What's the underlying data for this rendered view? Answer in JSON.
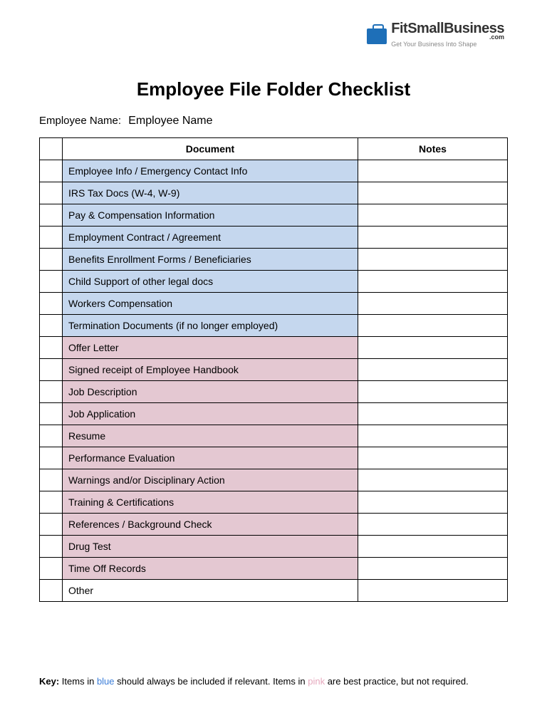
{
  "logo": {
    "brand": "FitSmallBusiness",
    "tag": "Get Your Business Into Shape",
    "dotcom": ".com"
  },
  "title": "Employee File Folder Checklist",
  "empLabel": "Employee Name:",
  "empValue": "Employee Name",
  "headers": {
    "doc": "Document",
    "notes": "Notes"
  },
  "rows": [
    {
      "text": "Employee Info / Emergency Contact Info",
      "cls": "blue"
    },
    {
      "text": "IRS Tax Docs (W-4, W-9)",
      "cls": "blue"
    },
    {
      "text": "Pay & Compensation Information",
      "cls": "blue"
    },
    {
      "text": "Employment Contract / Agreement",
      "cls": "blue"
    },
    {
      "text": "Benefits Enrollment Forms / Beneficiaries",
      "cls": "blue"
    },
    {
      "text": "Child Support of other legal docs",
      "cls": "blue"
    },
    {
      "text": "Workers Compensation",
      "cls": "blue"
    },
    {
      "text": "Termination Documents (if no longer employed)",
      "cls": "blue"
    },
    {
      "text": "Offer Letter",
      "cls": "pink"
    },
    {
      "text": "Signed receipt of Employee Handbook",
      "cls": "pink"
    },
    {
      "text": "Job Description",
      "cls": "pink"
    },
    {
      "text": "Job Application",
      "cls": "pink"
    },
    {
      "text": "Resume",
      "cls": "pink"
    },
    {
      "text": "Performance Evaluation",
      "cls": "pink"
    },
    {
      "text": "Warnings and/or Disciplinary Action",
      "cls": "pink"
    },
    {
      "text": "Training & Certifications",
      "cls": "pink"
    },
    {
      "text": "References / Background Check",
      "cls": "pink"
    },
    {
      "text": "Drug Test",
      "cls": "pink"
    },
    {
      "text": "Time Off Records",
      "cls": "pink"
    },
    {
      "text": "Other",
      "cls": ""
    }
  ],
  "key": {
    "label": "Key:",
    "t1": " Items in ",
    "blue": "blue",
    "t2": " should always be included if relevant. Items in ",
    "pink": "pink",
    "t3": " are best practice, but not required."
  }
}
